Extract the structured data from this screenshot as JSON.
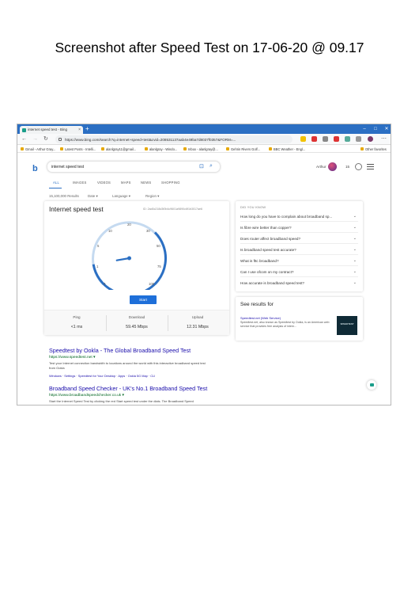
{
  "caption": "Screenshot after Speed Test on 17-06-20 @ 09.17",
  "browser": {
    "tab_title": "internet speed test - Bing",
    "url": "https://www.bing.com/search?q=internet+speed+test&cvid=208531137aab4e49ba7d8037f0357&FORM=...",
    "bookmarks": [
      "Gmail - Arthur Gray...",
      "Latest Posts - Intelli...",
      "alanlgray11@gmail...",
      "alanlgray - Windo...",
      "Inbox - alanlgray@...",
      "Gehrin Rivers Golf...",
      "BBC Weather - Engl..."
    ],
    "other_bookmarks": "Other favorites"
  },
  "bing": {
    "query": "internet speed test",
    "account_name": "Arthur",
    "reward_points": "15",
    "nav_tabs": [
      "ALL",
      "IMAGES",
      "VIDEOS",
      "MAPS",
      "NEWS",
      "SHOPPING"
    ],
    "result_count": "15,100,000 Results",
    "filters": [
      "Date ▾",
      "Language ▾",
      "Region ▾"
    ]
  },
  "speedtest": {
    "title": "Internet speed test",
    "test_id": "ID: 2ad0c218d3f0b4c9601a9890c6f1b3017ae6",
    "gauge_labels": [
      "0",
      "1",
      "5",
      "10",
      "20",
      "30",
      "50",
      "75",
      "100"
    ],
    "needle_mbps": 59.45,
    "start_label": "Start",
    "ping_label": "Ping",
    "download_label": "Download",
    "upload_label": "Upload",
    "ping_value": "<1 ms",
    "download_value": "59.45 Mbps",
    "upload_value": "12.31 Mbps"
  },
  "paa": {
    "heading": "DID YOU KNOW",
    "questions": [
      "How long do you have to complain about broadband sp...",
      "Is fibre wire better than copper?",
      "Does router affect broadband speed?",
      "Is broadband speed test accurate?",
      "What is fttc broadband?",
      "Can I use ofcom on my contract?",
      "How accurate is broadband speed test?"
    ]
  },
  "see_results": {
    "title": "See results for",
    "name": "Speedtest.net (Web Service)",
    "description": "Speedtest.net, also known as Speedtest by Ookla, is an American web service that provides free analysis of intern...",
    "thumb_text": "SPEEDTEST"
  },
  "results": [
    {
      "title": "Speedtest by Ookla - The Global Broadband Speed Test",
      "url": "https://www.speedtest.net ▾",
      "snippet": "Test your Internet connection bandwidth to locations around the world with this interactive broadband speed test from Ookla",
      "links": "Windows · Settings · Speedtest for Your Desktop · Apps · Ookla 5G Map · CLI"
    },
    {
      "title": "Broadband Speed Checker - UK's No.1 Broadband Speed Test",
      "url": "https://www.broadbandspeedchecker.co.uk ▾",
      "snippet": "Start the Internet Speed Test by clicking the red Start speed test under the dials. The Broadband Speed"
    }
  ]
}
